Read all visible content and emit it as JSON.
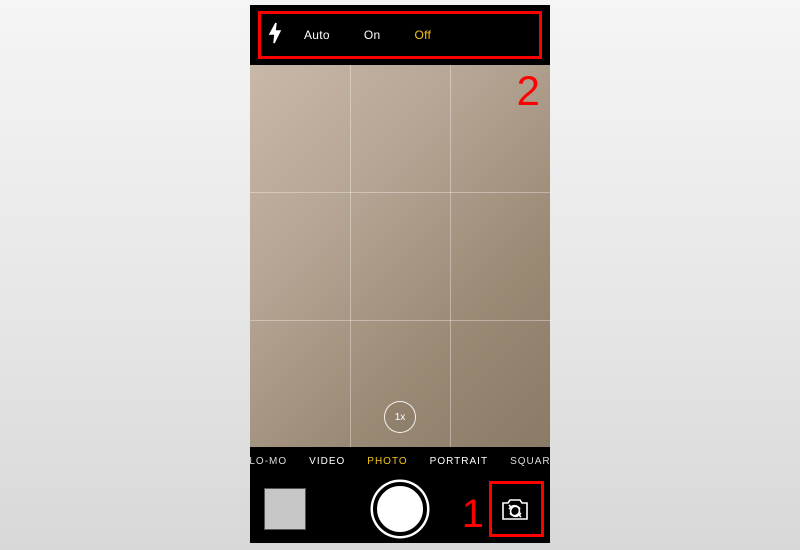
{
  "flash": {
    "options": {
      "auto": "Auto",
      "on": "On",
      "off": "Off"
    },
    "selected": "off"
  },
  "zoom": {
    "label": "1x"
  },
  "modes": {
    "slomo": "SLO-MO",
    "video": "VIDEO",
    "photo": "PHOTO",
    "portrait": "PORTRAIT",
    "square": "SQUARE",
    "active": "photo"
  },
  "annotations": {
    "label1": "1",
    "label2": "2"
  }
}
